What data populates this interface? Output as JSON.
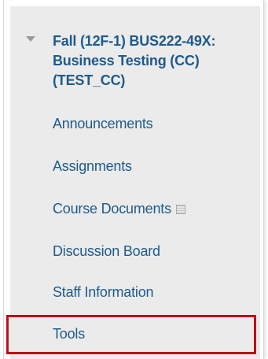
{
  "course": {
    "title": "Fall (12F-1) BUS222-49X: Business Testing (CC) (TEST_CC)"
  },
  "menu": {
    "items": [
      {
        "label": "Announcements"
      },
      {
        "label": "Assignments"
      },
      {
        "label": "Course Documents",
        "icon": "document-icon"
      },
      {
        "label": "Discussion Board"
      },
      {
        "label": "Staff Information"
      },
      {
        "label": "Tools"
      }
    ]
  },
  "colors": {
    "link": "#1e5a8c",
    "menu_background": "#ebebeb",
    "highlight_border": "#b80f1a"
  }
}
